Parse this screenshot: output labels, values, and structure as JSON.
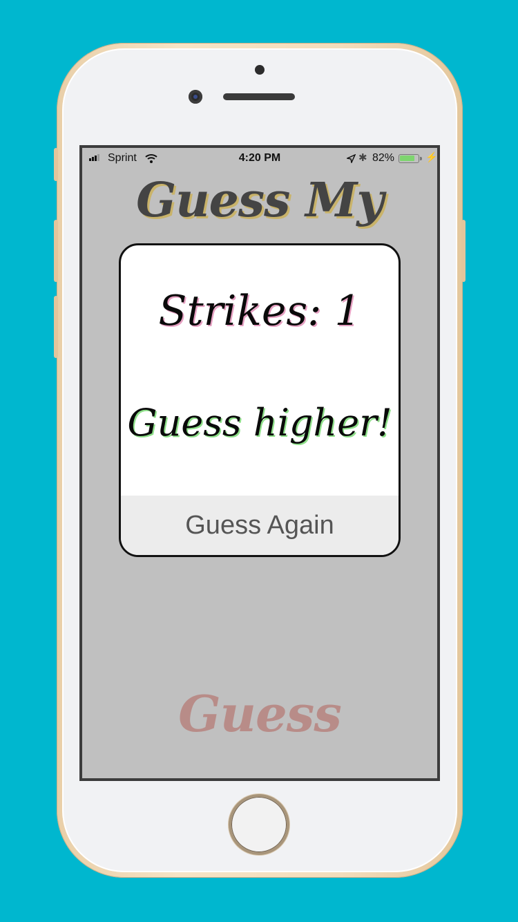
{
  "status_bar": {
    "carrier": "Sprint",
    "time": "4:20 PM",
    "battery_percent": "82%",
    "battery_level": 0.82,
    "battery_color": "#7ed56f"
  },
  "app": {
    "title": "Guess My",
    "guess_label": "Guess"
  },
  "alert": {
    "strikes": "Strikes: 1",
    "message": "Guess higher!",
    "action_label": "Guess Again"
  },
  "colors": {
    "background": "#00b7cf",
    "screen": "#c0c0c0",
    "title_shadow": "#c9b36a",
    "strikes_shadow": "#e6a0c2",
    "message_shadow": "#8fe08a"
  }
}
